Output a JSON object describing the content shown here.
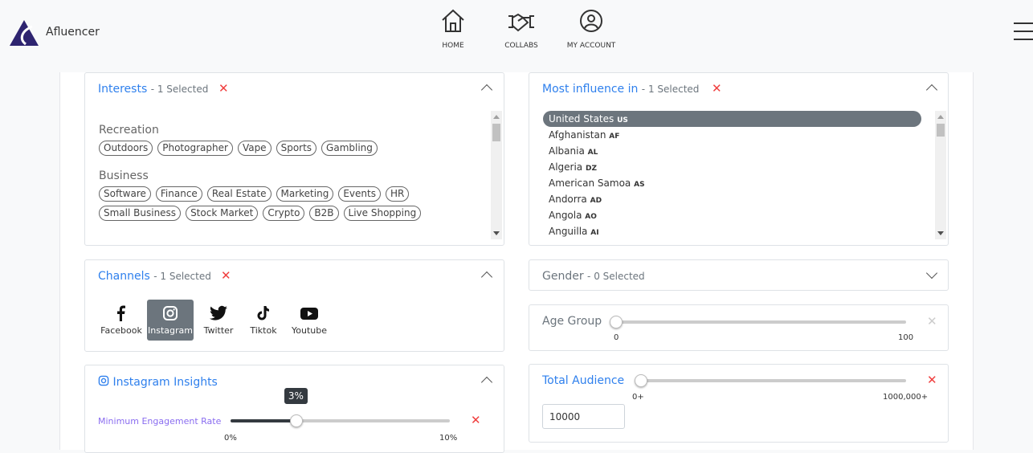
{
  "header": {
    "brand": "Afluencer",
    "nav": [
      {
        "label": "HOME",
        "icon": "home-icon"
      },
      {
        "label": "COLLABS",
        "icon": "handshake-icon"
      },
      {
        "label": "MY ACCOUNT",
        "icon": "account-icon"
      }
    ],
    "menu_icon": "hamburger-icon"
  },
  "interests": {
    "title": "Interests",
    "selected": "- 1 Selected",
    "groups": [
      {
        "name": "Recreation",
        "tags": [
          "Outdoors",
          "Photographer",
          "Vape",
          "Sports",
          "Gambling"
        ]
      },
      {
        "name": "Business",
        "tags": [
          "Software",
          "Finance",
          "Real Estate",
          "Marketing",
          "Events",
          "HR",
          "Small Business",
          "Stock Market",
          "Crypto",
          "B2B",
          "Live Shopping"
        ]
      }
    ]
  },
  "channels": {
    "title": "Channels",
    "selected": "- 1 Selected",
    "items": [
      {
        "label": "Facebook",
        "icon": "facebook-icon",
        "active": false
      },
      {
        "label": "Instagram",
        "icon": "instagram-icon",
        "active": true
      },
      {
        "label": "Twitter",
        "icon": "twitter-icon",
        "active": false
      },
      {
        "label": "Tiktok",
        "icon": "tiktok-icon",
        "active": false
      },
      {
        "label": "Youtube",
        "icon": "youtube-icon",
        "active": false
      }
    ]
  },
  "insights": {
    "title": "Instagram Insights",
    "engagement_label": "Minimum Engagement Rate",
    "value": 3,
    "tooltip": "3%",
    "min": "0%",
    "max": "10%"
  },
  "influence": {
    "title": "Most influence in",
    "selected": "- 1 Selected",
    "countries": [
      {
        "name": "United States",
        "code": "US",
        "selected": true
      },
      {
        "name": "Afghanistan",
        "code": "AF"
      },
      {
        "name": "Albania",
        "code": "AL"
      },
      {
        "name": "Algeria",
        "code": "DZ"
      },
      {
        "name": "American Samoa",
        "code": "AS"
      },
      {
        "name": "Andorra",
        "code": "AD"
      },
      {
        "name": "Angola",
        "code": "AO"
      },
      {
        "name": "Anguilla",
        "code": "AI"
      }
    ]
  },
  "gender": {
    "title": "Gender",
    "selected": "- 0 Selected"
  },
  "age": {
    "title": "Age Group",
    "min": "0",
    "max": "100"
  },
  "audience": {
    "title": "Total Audience",
    "min": "0+",
    "max": "1000,000+",
    "input_value": "10000"
  },
  "colors": {
    "accent": "#2f80ed",
    "clear": "#f03e3e",
    "selected_bg": "#6c757d"
  }
}
